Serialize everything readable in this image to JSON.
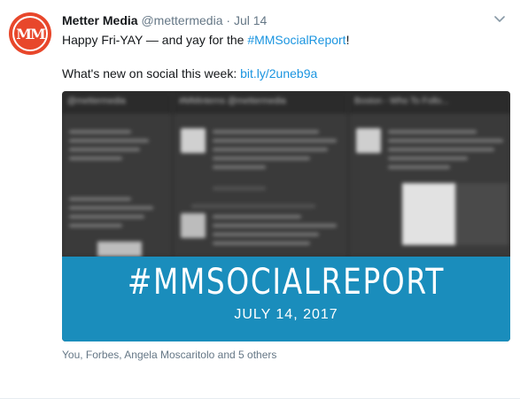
{
  "tweet": {
    "author_name": "Metter Media",
    "author_handle": "@mettermedia",
    "separator": "·",
    "date": "Jul 14",
    "avatar_text": "MM",
    "line1_text": "Happy Fri-YAY — and yay for the ",
    "line1_hashtag": "#MMSocialReport",
    "line1_end": "!",
    "line2_text": "What's new on social this week: ",
    "line2_link": "bit.ly/2uneb9a",
    "liked_by": "You, Forbes, Angela Moscaritolo and 5 others"
  },
  "media": {
    "columns": [
      "@mettermedia",
      "#MMinterns @mettermedia",
      "Boston - Who To Follo..."
    ],
    "banner_hashtag": "#MMSOCIALREPORT",
    "banner_date": "JULY 14, 2017"
  },
  "colors": {
    "link": "#1b95e0",
    "avatar_bg": "#e8472b",
    "banner_bg": "#1a8dbc",
    "muted": "#657786"
  },
  "icons": {
    "caret": "chevron-down-icon"
  }
}
